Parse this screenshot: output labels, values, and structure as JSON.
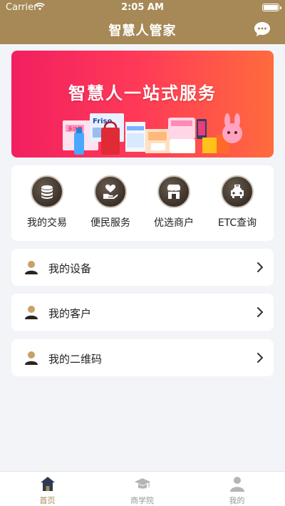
{
  "status_bar": {
    "carrier": "Carrier",
    "time": "2:05 AM"
  },
  "header": {
    "title": "智慧人管家",
    "chat_icon": "chat-bubble-icon",
    "bg_color": "#a68956"
  },
  "banner": {
    "headline": "智慧人一站式服务",
    "product_brand": "Friso",
    "product_text": "多功能"
  },
  "services": [
    {
      "label": "我的交易",
      "icon": "coins-icon"
    },
    {
      "label": "便民服务",
      "icon": "heart-hand-icon"
    },
    {
      "label": "优选商户",
      "icon": "shop-icon"
    },
    {
      "label": "ETC查询",
      "icon": "car-icon"
    }
  ],
  "menu": [
    {
      "label": "我的设备",
      "icon": "person-icon"
    },
    {
      "label": "我的客户",
      "icon": "person-icon"
    },
    {
      "label": "我的二维码",
      "icon": "person-icon"
    }
  ],
  "tabbar": [
    {
      "label": "首页",
      "icon": "home-icon",
      "active": true
    },
    {
      "label": "商学院",
      "icon": "graduation-cap-icon",
      "active": false
    },
    {
      "label": "我的",
      "icon": "profile-icon",
      "active": false
    }
  ],
  "colors": {
    "accent": "#a68956",
    "banner_start": "#f21f60",
    "banner_end": "#ff6b3d",
    "icon_dark": "#3f342c"
  }
}
